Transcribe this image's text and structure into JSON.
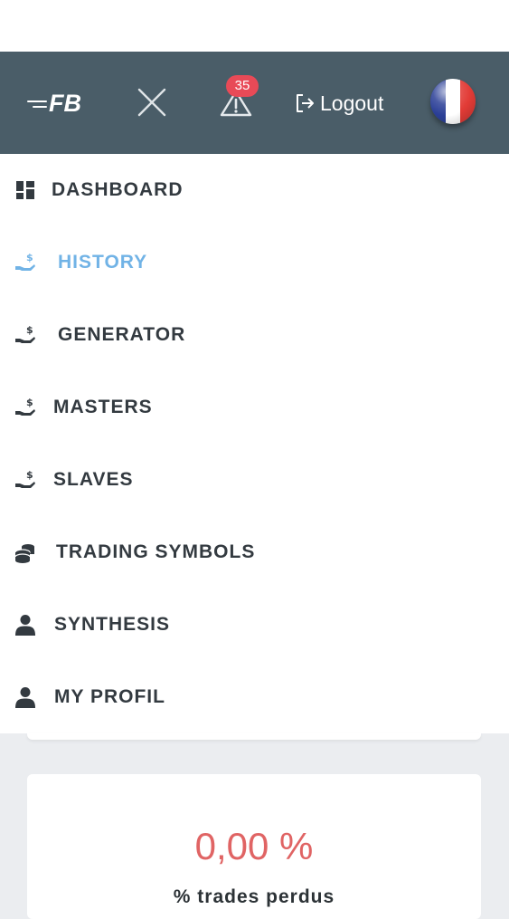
{
  "header": {
    "logo_text": "FB",
    "alert_count": "35",
    "logout_label": "Logout",
    "flag_colors": [
      "#2b3f97",
      "#ffffff",
      "#e23b36"
    ],
    "background": "#4a5d68"
  },
  "menu": {
    "items": [
      {
        "label": "DASHBOARD",
        "icon": "dashboard-icon"
      },
      {
        "label": "HISTORY",
        "icon": "hand-dollar-icon",
        "active": true
      },
      {
        "label": "GENERATOR",
        "icon": "hand-dollar-icon"
      },
      {
        "label": "MASTERS",
        "icon": "hand-dollar-icon"
      },
      {
        "label": "SLAVES",
        "icon": "hand-dollar-icon"
      },
      {
        "label": "TRADING SYMBOLS",
        "icon": "coins-icon"
      },
      {
        "label": "SYNTHESIS",
        "icon": "user-icon"
      },
      {
        "label": "MY PROFIL",
        "icon": "user-icon"
      }
    ],
    "active_color": "#71b3e6"
  },
  "stat_card": {
    "value": "0,00 %",
    "label": "% trades perdus",
    "value_color": "#e06464"
  }
}
